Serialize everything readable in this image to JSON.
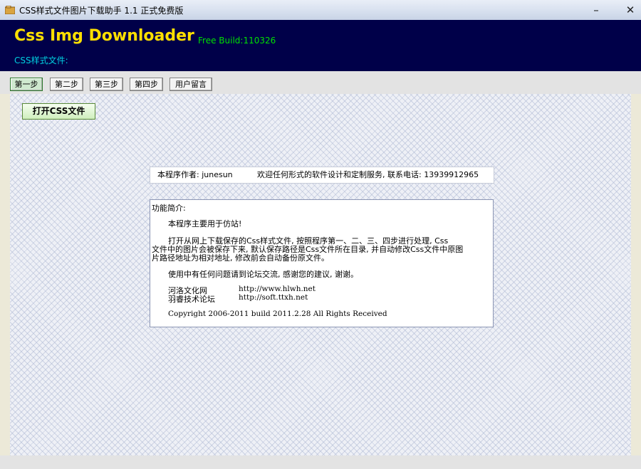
{
  "window": {
    "title": "CSS样式文件图片下载助手 1.1 正式免费版",
    "min_glyph": "–",
    "close_glyph": "✕"
  },
  "header": {
    "app_name": "Css Img Downloader",
    "build": "Free Build:110326",
    "css_file_label": "CSS样式文件:"
  },
  "tabs": [
    {
      "label": "第一步",
      "active": true
    },
    {
      "label": "第二步"
    },
    {
      "label": "第三步"
    },
    {
      "label": "第四步"
    },
    {
      "label": "用户留言"
    }
  ],
  "open_button": {
    "label": "打开CSS文件"
  },
  "author": {
    "name": "本程序作者: junesun",
    "service": "欢迎任何形式的软件设计和定制服务, 联系电话: 13939912965"
  },
  "intro": {
    "heading": "功能简介:",
    "line1": "本程序主要用于仿站!",
    "para2_line1": "打开从网上下载保存的Css样式文件, 按照程序第一、二、三、四步进行处理, Css",
    "para2_line2": "文件中的图片会被保存下来, 默认保存路径是Css文件所在目录, 并自动修改Css文件中原图",
    "para2_line3": "片路径地址为相对地址, 修改前会自动备份原文件。",
    "para3": "使用中有任何问题请到论坛交流, 感谢您的建议, 谢谢。",
    "site1_name": "河洛文化网",
    "site1_url": "http://www.hlwh.net",
    "site2_name": "羽睿技术论坛",
    "site2_url": "http://soft.ttxh.net",
    "copyright": "Copyright 2006-2011  build 2011.2.28  All Rights Received"
  }
}
